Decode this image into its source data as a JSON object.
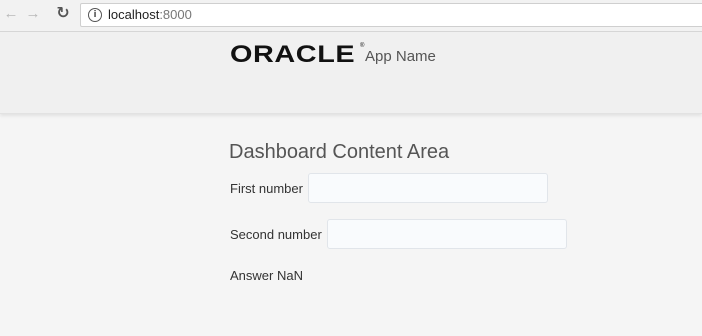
{
  "browser": {
    "url_host": "localhost",
    "url_port": ":8000",
    "icons": {
      "back": "back-arrow-icon",
      "forward": "forward-arrow-icon",
      "reload": "reload-icon",
      "info": "info-icon"
    }
  },
  "header": {
    "logo_text": "ORACLE",
    "logo_mark": "®",
    "app_name": "App Name"
  },
  "main": {
    "title": "Dashboard Content Area",
    "first_label": "First number",
    "first_value": "",
    "second_label": "Second number",
    "second_value": "",
    "answer_label": "Answer",
    "answer_value": "NaN"
  }
}
